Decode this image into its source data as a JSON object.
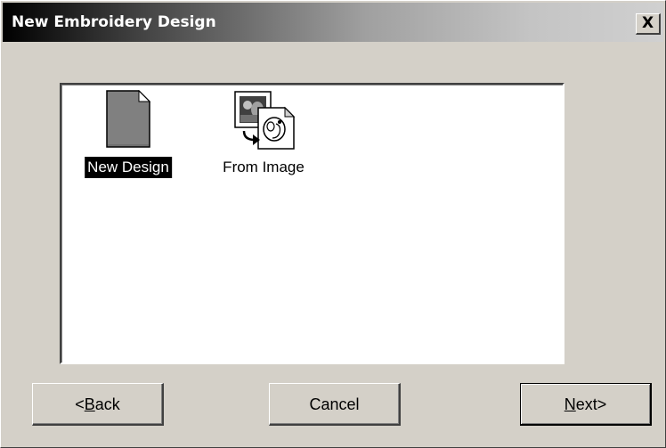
{
  "window": {
    "title": "New Embroidery Design",
    "close_label": "X"
  },
  "items": [
    {
      "label": "New Design",
      "icon": "blank-document-icon",
      "selected": true
    },
    {
      "label": "From Image",
      "icon": "image-conversion-icon",
      "selected": false
    }
  ],
  "buttons": {
    "back": {
      "prefix": "<",
      "accel": "B",
      "rest": "ack"
    },
    "cancel": {
      "label": "Cancel"
    },
    "next": {
      "accel": "N",
      "rest": "ext>"
    }
  },
  "colors": {
    "selection_bg": "#000000",
    "face": "#d4d0c8",
    "list_bg": "#ffffff"
  }
}
